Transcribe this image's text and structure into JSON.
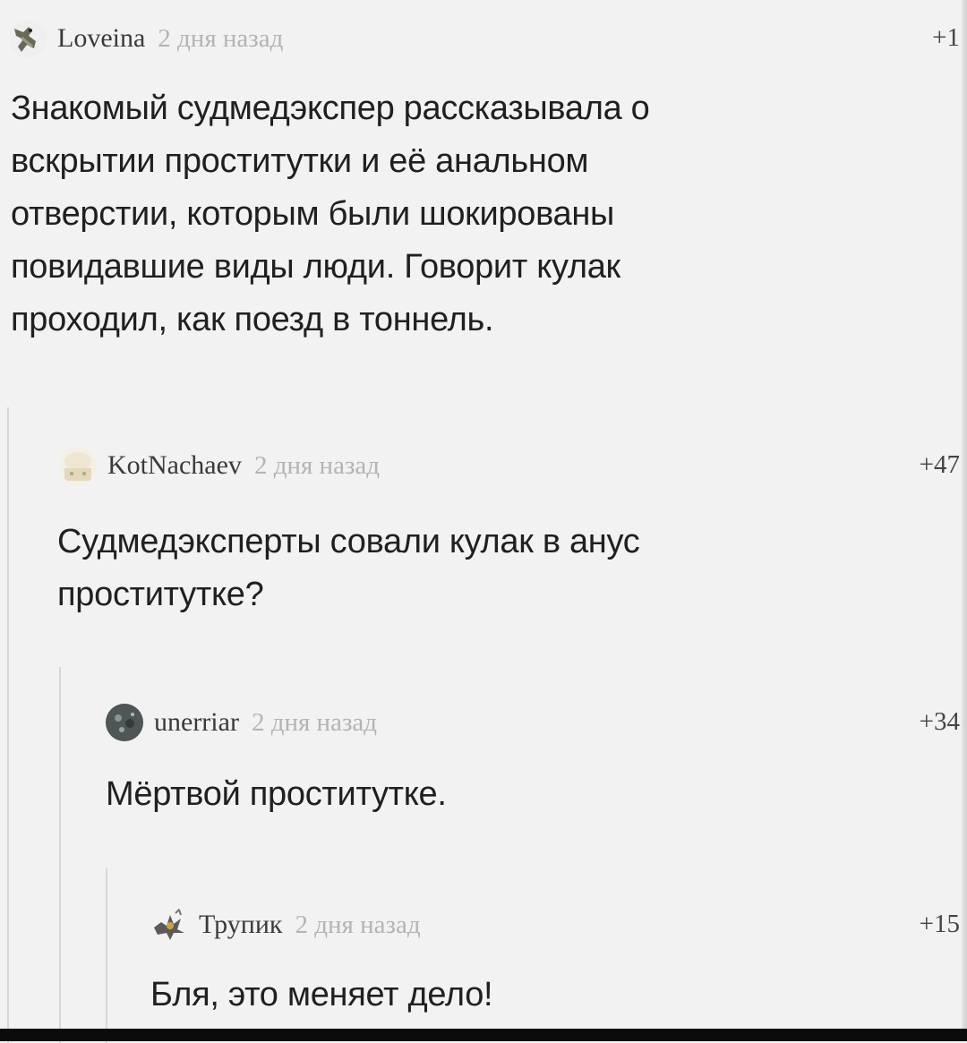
{
  "comments": [
    {
      "username": "Loveina",
      "time": "2 дня назад",
      "rating": "+1",
      "text": "Знакомый судмедэкспер рассказывала о\nвскрытии проститутки и её анальном\nотверстии, которым были шокированы\nповидавшие виды люди. Говорит кулак\nпроходил, как поезд в тоннель.",
      "avatar_icon": "giraffe-avatar-icon"
    },
    {
      "username": "KotNachaev",
      "time": "2 дня назад",
      "rating": "+47",
      "text": "Судмедэксперты совали кулак в анус\nпроститутке?",
      "avatar_icon": "cat-avatar-icon"
    },
    {
      "username": "unerriar",
      "time": "2 дня назад",
      "rating": "+34",
      "text": "Мёртвой проститутке.",
      "avatar_icon": "dark-round-avatar-icon"
    },
    {
      "username": "Трупик",
      "time": "2 дня назад",
      "rating": "+15",
      "text": "Бля, это меняет дело!",
      "avatar_icon": "creature-avatar-icon"
    }
  ],
  "colors": {
    "background": "#f2f2f2",
    "text": "#202020",
    "username": "#3a3a3a",
    "time": "#b4b4b4",
    "branch_line": "#d6d6d6"
  }
}
